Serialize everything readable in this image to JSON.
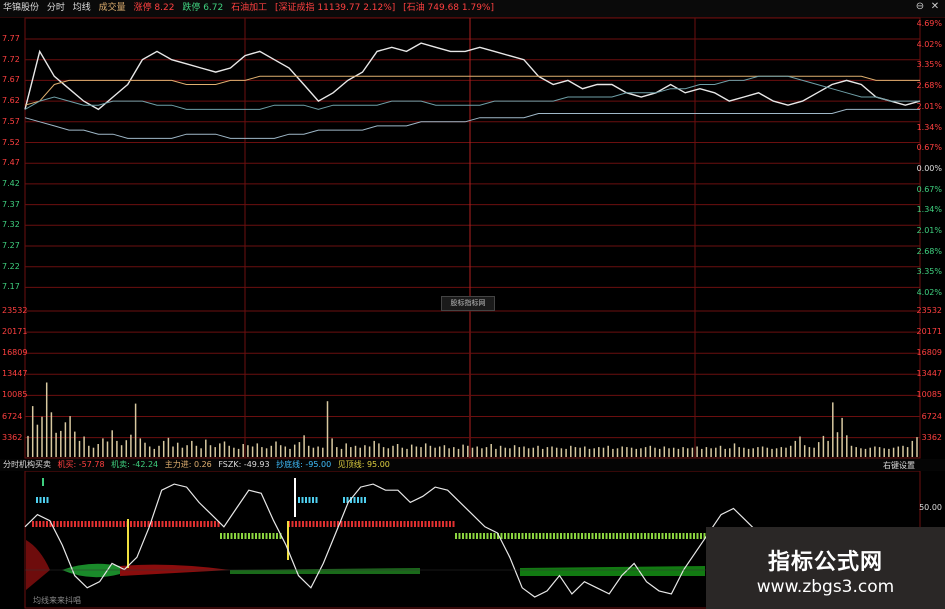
{
  "header": {
    "stock_name": "华锦股份",
    "tab_intraday": "分时",
    "tab_avg": "均线",
    "tab_volume": "成交量",
    "limit_up": "涨停 8.22",
    "limit_down": "跌停 6.72",
    "sector": "石油加工",
    "index1": "[深证成指 11139.77 2.12%]",
    "index2": "[石油 749.68 1.79%]"
  },
  "window_buttons": [
    "⊖",
    "✕"
  ],
  "price_axis": {
    "left": [
      "7.77",
      "7.72",
      "7.67",
      "7.62",
      "7.57",
      "7.52",
      "7.47",
      "7.42",
      "7.37",
      "7.32",
      "7.27",
      "7.22",
      "7.17"
    ],
    "right": [
      "4.69%",
      "4.02%",
      "3.35%",
      "2.68%",
      "2.01%",
      "1.34%",
      "0.67%",
      "0.00%",
      "0.67%",
      "1.34%",
      "2.01%",
      "2.68%",
      "3.35%",
      "4.02%"
    ]
  },
  "volume_axis": {
    "left": [
      "23532",
      "20171",
      "16809",
      "13447",
      "10085",
      "6724",
      "3362"
    ],
    "right": [
      "23532",
      "20171",
      "16809",
      "13447",
      "10085",
      "6724",
      "3362"
    ]
  },
  "center_tag": "股标指标网",
  "indicator": {
    "name": "分时机构买卖",
    "buy_label": "机买: -57.78",
    "sell_label": "机卖: -42.24",
    "main_label": "主力进: 0.26",
    "fsz_label": "FSZK: -49.93",
    "bottom_label": "抄底线: -95.00",
    "top_label": "见顶线: 95.00",
    "right_settings": "右键设置",
    "right_axis": [
      "50.00"
    ],
    "footer": "均线来来抖唱"
  },
  "watermark": {
    "title": "指标公式网",
    "url": "www.zbgs3.com"
  },
  "colors": {
    "up": "#ff4040",
    "down": "#3fd07f",
    "grid": "#6b0f0f",
    "price_line": "#e8e8e8",
    "avg_line": "#e0b070",
    "volume": "#d8c9a0"
  },
  "chart_data": [
    {
      "type": "line",
      "title": "",
      "ylim": [
        7.17,
        7.77
      ],
      "series": [
        {
          "name": "",
          "values": [
            7.6,
            7.74,
            7.68,
            7.65,
            7.62,
            7.6,
            7.63,
            7.66,
            7.72,
            7.74,
            7.72,
            7.71,
            7.7,
            7.69,
            7.7,
            7.73,
            7.74,
            7.72,
            7.7,
            7.66,
            7.62,
            7.64,
            7.67,
            7.69,
            7.74,
            7.75,
            7.74,
            7.76,
            7.75,
            7.74,
            7.74,
            7.75,
            7.74,
            7.73,
            7.72,
            7.68,
            7.66,
            7.67,
            7.65,
            7.66,
            7.66,
            7.64,
            7.63,
            7.64,
            7.66,
            7.64,
            7.65,
            7.64,
            7.62,
            7.63,
            7.64,
            7.62,
            7.61,
            7.62,
            7.64,
            7.66,
            7.67,
            7.66,
            7.63,
            7.62,
            7.61,
            7.62
          ]
        },
        {
          "name": "",
          "values": [
            7.61,
            7.62,
            7.66,
            7.67,
            7.67,
            7.67,
            7.67,
            7.67,
            7.67,
            7.67,
            7.67,
            7.66,
            7.66,
            7.66,
            7.67,
            7.67,
            7.68,
            7.68,
            7.68,
            7.68,
            7.68,
            7.68,
            7.68,
            7.68,
            7.68,
            7.68,
            7.68,
            7.68,
            7.68,
            7.68,
            7.68,
            7.68,
            7.68,
            7.68,
            7.68,
            7.68,
            7.68,
            7.68,
            7.68,
            7.68,
            7.68,
            7.68,
            7.68,
            7.68,
            7.68,
            7.68,
            7.68,
            7.68,
            7.68,
            7.68,
            7.68,
            7.68,
            7.68,
            7.68,
            7.68,
            7.68,
            7.68,
            7.68,
            7.67,
            7.67,
            7.67,
            7.67
          ]
        },
        {
          "name": "",
          "values": [
            7.58,
            7.57,
            7.56,
            7.55,
            7.55,
            7.54,
            7.54,
            7.53,
            7.53,
            7.53,
            7.53,
            7.54,
            7.54,
            7.54,
            7.53,
            7.53,
            7.53,
            7.53,
            7.54,
            7.54,
            7.55,
            7.55,
            7.55,
            7.55,
            7.56,
            7.56,
            7.56,
            7.57,
            7.57,
            7.57,
            7.57,
            7.58,
            7.58,
            7.58,
            7.58,
            7.59,
            7.59,
            7.59,
            7.59,
            7.59,
            7.59,
            7.59,
            7.59,
            7.59,
            7.59,
            7.59,
            7.59,
            7.59,
            7.59,
            7.59,
            7.59,
            7.59,
            7.59,
            7.59,
            7.59,
            7.59,
            7.6,
            7.6,
            7.6,
            7.6,
            7.6,
            7.6
          ]
        },
        {
          "name": "",
          "values": [
            7.6,
            7.62,
            7.63,
            7.62,
            7.61,
            7.61,
            7.62,
            7.62,
            7.62,
            7.61,
            7.61,
            7.6,
            7.6,
            7.6,
            7.6,
            7.6,
            7.6,
            7.61,
            7.61,
            7.61,
            7.6,
            7.61,
            7.61,
            7.61,
            7.61,
            7.62,
            7.62,
            7.62,
            7.61,
            7.61,
            7.61,
            7.61,
            7.62,
            7.62,
            7.62,
            7.62,
            7.62,
            7.63,
            7.63,
            7.63,
            7.63,
            7.64,
            7.64,
            7.64,
            7.65,
            7.65,
            7.66,
            7.66,
            7.67,
            7.67,
            7.68,
            7.68,
            7.68,
            7.67,
            7.66,
            7.65,
            7.64,
            7.63,
            7.63,
            7.62,
            7.62,
            7.62
          ]
        }
      ]
    },
    {
      "type": "bar",
      "title": "",
      "ylim": [
        0,
        23532
      ],
      "values": [
        3400,
        8200,
        5200,
        6500,
        12000,
        7200,
        3900,
        4200,
        5600,
        6600,
        4100,
        2600,
        3300,
        1800,
        1500,
        2100,
        3000,
        2500,
        4300,
        2600,
        1900,
        2700,
        3600,
        8600,
        3000,
        2300,
        1700,
        1300,
        1800,
        2600,
        3100,
        1700,
        2300,
        1500,
        1900,
        2600,
        1800,
        1400,
        2800,
        1900,
        1600,
        2200,
        2500,
        1800,
        1500,
        1300,
        2100,
        1900,
        1700,
        2200,
        1600,
        1400,
        1800,
        2500,
        1900,
        1700,
        1300,
        2000,
        2400,
        3500,
        1800,
        1500,
        1700,
        1500,
        9000,
        3000,
        1600,
        1300,
        2200,
        1600,
        1800,
        1500,
        1900,
        1700,
        2600,
        2200,
        1600,
        1400,
        1800,
        2100,
        1500,
        1300,
        2000,
        1700,
        1600,
        2200,
        1800,
        1500,
        1700,
        1900,
        1400,
        1600,
        1300,
        2000,
        1800,
        1500,
        1700,
        1400,
        1600,
        2100,
        1300,
        1800,
        1500,
        1400,
        1900,
        1600,
        1700,
        1400,
        1500,
        1800,
        1300,
        1600,
        1700,
        1500,
        1400,
        1300,
        1800,
        1600,
        1500,
        1700,
        1300,
        1400,
        1600,
        1500,
        1800,
        1300,
        1400,
        1700,
        1600,
        1500,
        1300,
        1400,
        1600,
        1800,
        1500,
        1300,
        1700,
        1400,
        1500,
        1300,
        1600,
        1400,
        1500,
        1700,
        1300,
        1600,
        1400,
        1500,
        1800,
        1300,
        1400,
        2200,
        1600,
        1500,
        1300,
        1400,
        1600,
        1700,
        1500,
        1300,
        1400,
        1600,
        1500,
        1800,
        2600,
        3300,
        1900,
        1600,
        1500,
        2400,
        3400,
        2600,
        8800,
        4000,
        6300,
        3500,
        1800,
        1600,
        1400,
        1300,
        1500,
        1700,
        1600,
        1400,
        1300,
        1500,
        1700,
        1800,
        1600,
        2600,
        3200
      ]
    },
    {
      "type": "line",
      "title": "",
      "ylim": [
        -100,
        100
      ],
      "series": [
        {
          "name": "",
          "values": [
            20,
            40,
            30,
            -10,
            -60,
            -80,
            -70,
            -40,
            -50,
            -30,
            20,
            80,
            90,
            85,
            60,
            40,
            20,
            50,
            80,
            75,
            30,
            -10,
            -60,
            -80,
            -40,
            10,
            60,
            85,
            90,
            80,
            80,
            60,
            70,
            85,
            80,
            60,
            40,
            20,
            10,
            -30,
            -80,
            -95,
            -85,
            -60,
            -90,
            -70,
            -80,
            -90,
            -60,
            -40,
            -70,
            -85,
            -90,
            -50,
            -20,
            10,
            40,
            50,
            30,
            10,
            -50,
            -80,
            -60,
            -30,
            -10,
            -30,
            -60,
            -40,
            -20,
            0,
            -20,
            -40,
            -10
          ]
        }
      ]
    }
  ]
}
